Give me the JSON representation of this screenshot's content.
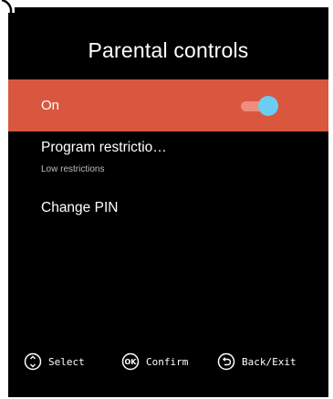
{
  "title": "Parental controls",
  "items": [
    {
      "label": "On",
      "toggle_on": true
    },
    {
      "label": "Program restrictio…",
      "sublabel": "Low restrictions"
    },
    {
      "label": "Change PIN"
    }
  ],
  "footer": {
    "select": {
      "icon": "dpad-icon",
      "label": "Select"
    },
    "confirm": {
      "icon": "ok-button-icon",
      "label": "Confirm",
      "icon_text": "OK"
    },
    "back": {
      "icon": "back-arrow-icon",
      "label": "Back/Exit"
    }
  },
  "colors": {
    "background": "#000000",
    "highlight": "#d9573e",
    "toggle_track": "#f08d7e",
    "toggle_thumb": "#6ccdf3",
    "text": "#ffffff",
    "subtext": "#bdbdbd"
  }
}
